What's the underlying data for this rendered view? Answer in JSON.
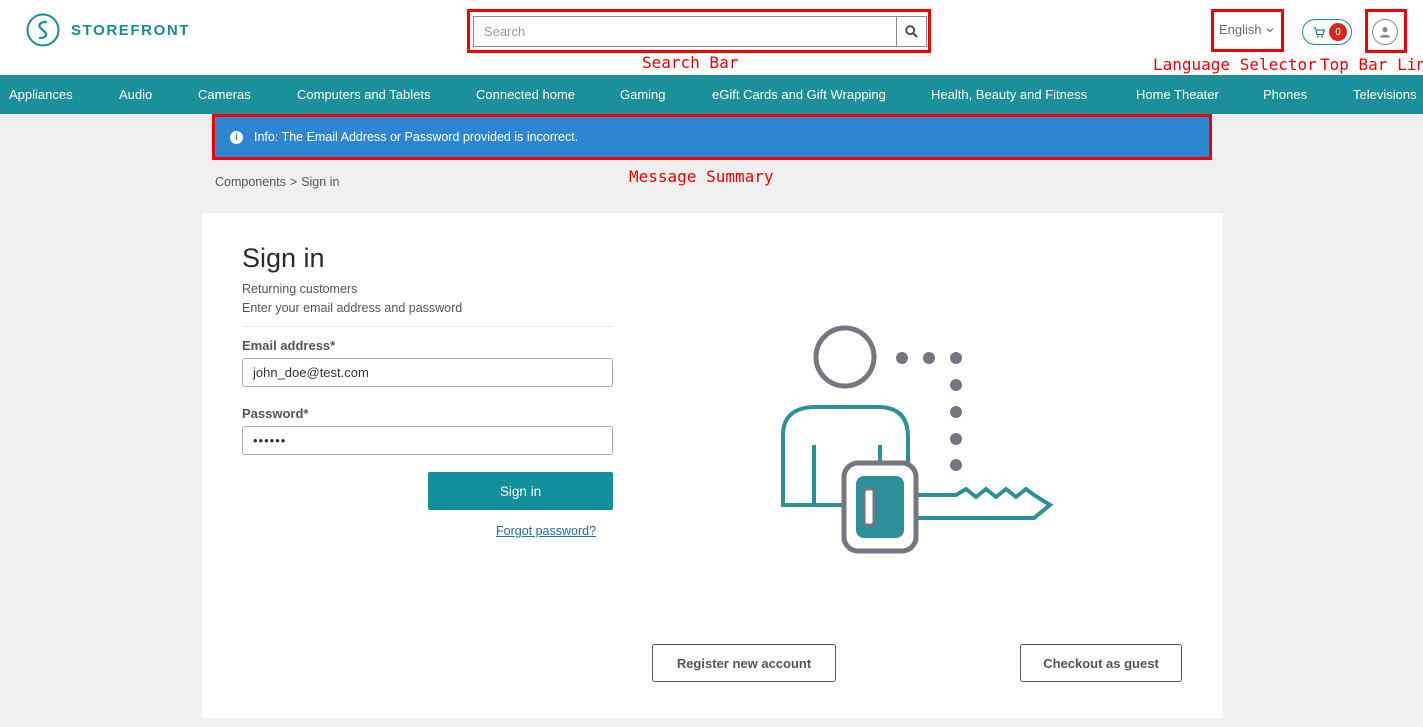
{
  "header": {
    "brand": "STOREFRONT",
    "search_placeholder": "Search",
    "language": "English",
    "cart_count": "0"
  },
  "annotations": {
    "search": "Search Bar",
    "language": "Language Selector",
    "topbar": "Top Bar Link",
    "message": "Message Summary",
    "color": "#e00000"
  },
  "nav": {
    "items": [
      "Appliances",
      "Audio",
      "Cameras",
      "Computers and Tablets",
      "Connected home",
      "Gaming",
      "eGift Cards and Gift Wrapping",
      "Health, Beauty and Fitness",
      "Home Theater",
      "Phones",
      "Televisions"
    ]
  },
  "message": {
    "icon": "info-icon",
    "text": "Info: The Email Address or Password provided is incorrect."
  },
  "breadcrumb": {
    "parent": "Components",
    "separator": ">",
    "current": "Sign in"
  },
  "signin": {
    "title": "Sign in",
    "subtitle": "Returning customers",
    "instructions": "Enter your email address and password",
    "email_label": "Email address*",
    "email_value": "john_doe@test.com",
    "password_label": "Password*",
    "password_value": "••••••",
    "submit_label": "Sign in",
    "forgot_label": "Forgot password?",
    "register_label": "Register new account",
    "guest_label": "Checkout as guest"
  },
  "colors": {
    "brand_teal": "#1b8f9a",
    "info_blue": "#2e86d0",
    "badge_red": "#d0271e"
  }
}
